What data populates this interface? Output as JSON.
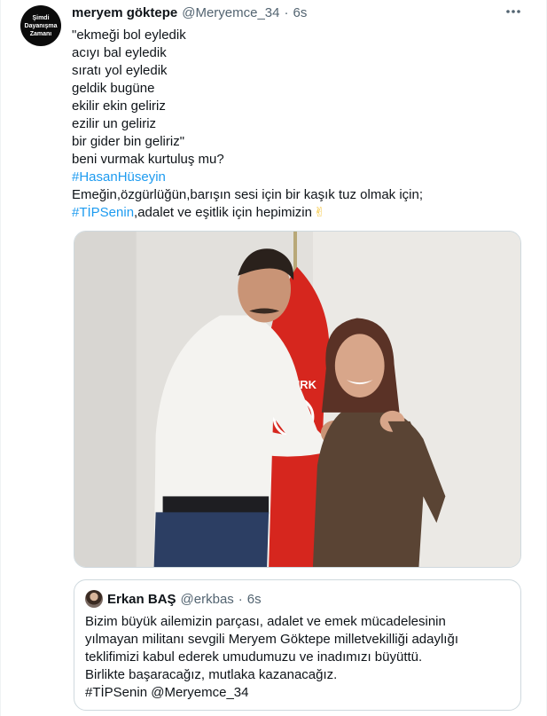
{
  "tweet": {
    "avatar_text": [
      "Şimdi",
      "Dayanışma",
      "Zamanı"
    ],
    "author_name": "meryem göktepe",
    "author_handle": "@Meryemce_34",
    "separator": "·",
    "time": "6s",
    "more_icon": "more-horizontal-icon",
    "lines": [
      "\"ekmeği bol eyledik",
      "acıyı bal eyledik",
      "sıratı yol eyledik",
      "geldik bugüne",
      "ekilir ekin geliriz",
      "ezilir un geliriz",
      "bir gider bin geliriz\"",
      "beni vurmak kurtuluş mu?"
    ],
    "hashtag1": "#HasanHüseyin",
    "line_after_hashtag": "Emeğin,özgürlüğün,barışın sesi için bir kaşık tuz olmak için;",
    "hashtag2": "#TİPSenin",
    "line_end": ",adalet ve eşitlik için hepimizin",
    "emoji": "✌"
  },
  "photo": {
    "flag_text": "TÜRK",
    "flag_color": "#d6261e"
  },
  "quote": {
    "name": "Erkan BAŞ",
    "handle": "@erkbas",
    "separator": "·",
    "time": "6s",
    "lines": [
      "Bizim büyük ailemizin parçası, adalet ve emek mücadelesinin",
      "yılmayan militanı sevgili Meryem Göktepe milletvekilliği adaylığı",
      "teklifimizi kabul ederek umudumuzu ve inadımızı büyüttü.",
      "Birlikte başaracağız, mutlaka kazanacağız."
    ],
    "last_hashtag": "#TİPSenin",
    "last_mention": "@Meryemce_34"
  },
  "colors": {
    "link": "#1d9bf0",
    "secondary_text": "#536471",
    "border": "#cfd9de"
  }
}
